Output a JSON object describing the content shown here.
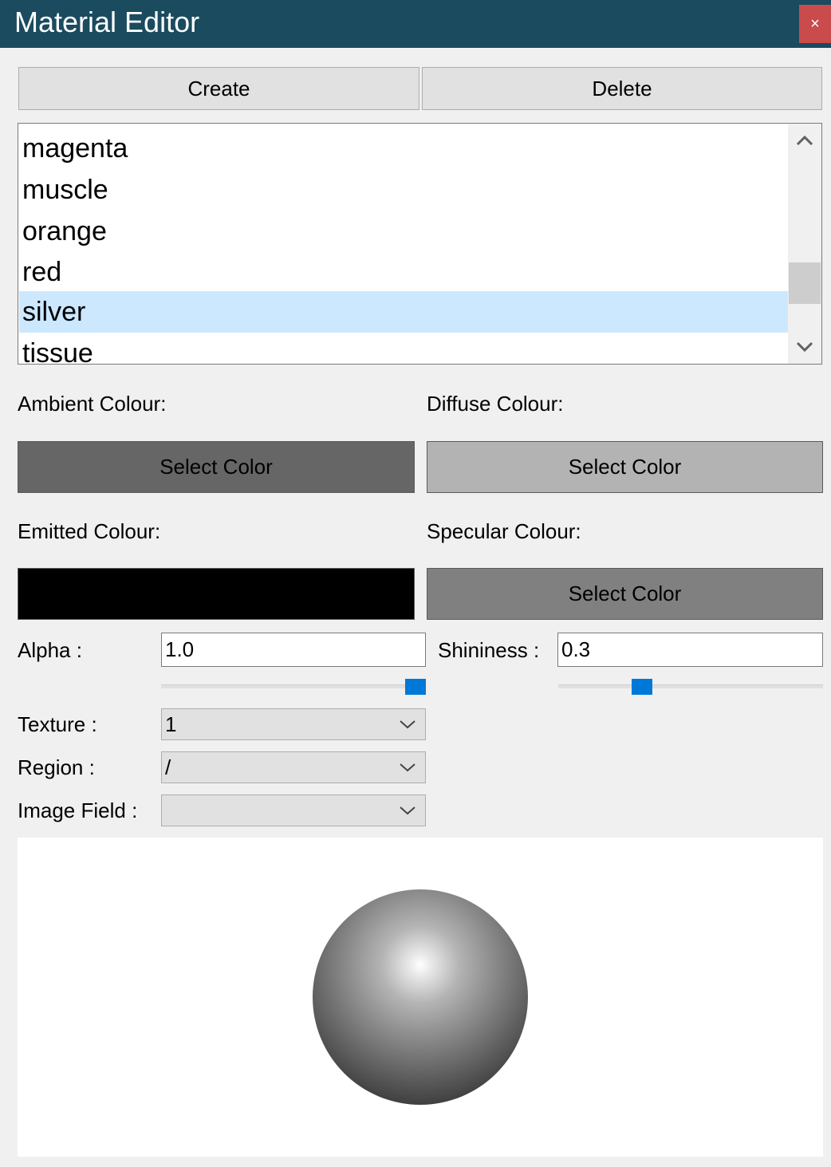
{
  "window": {
    "title": "Material Editor",
    "close_label": "×"
  },
  "toolbar": {
    "create_label": "Create",
    "delete_label": "Delete"
  },
  "materials": {
    "items": [
      "magenta",
      "muscle",
      "orange",
      "red",
      "silver",
      "tissue"
    ],
    "selected": "silver"
  },
  "colours": {
    "ambient": {
      "label": "Ambient Colour:",
      "button": "Select Color",
      "value": "#666666"
    },
    "diffuse": {
      "label": "Diffuse Colour:",
      "button": "Select Color",
      "value": "#b3b3b3"
    },
    "emitted": {
      "label": "Emitted Colour:",
      "button": "",
      "value": "#000000"
    },
    "specular": {
      "label": "Specular Colour:",
      "button": "Select Color",
      "value": "#808080"
    }
  },
  "alpha": {
    "label": "Alpha :",
    "value": "1.0",
    "slider_fraction": 1.0
  },
  "shininess": {
    "label": "Shininess :",
    "value": "0.3",
    "slider_fraction": 0.3
  },
  "texture": {
    "label": "Texture :",
    "value": "1"
  },
  "region": {
    "label": "Region :",
    "value": "/"
  },
  "image_field": {
    "label": "Image Field :",
    "value": ""
  },
  "icons": {
    "scroll_up": "chevron-up-icon",
    "scroll_down": "chevron-down-icon",
    "dropdown": "chevron-down-icon"
  }
}
